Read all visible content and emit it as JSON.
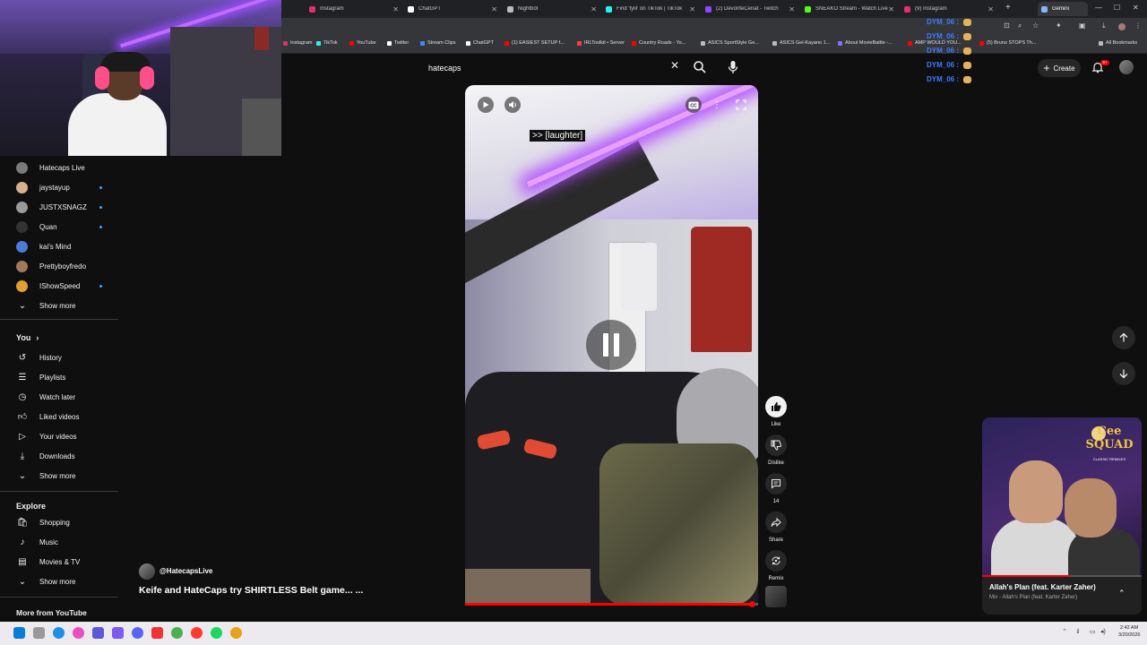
{
  "browser": {
    "tabs": [
      {
        "title": "Instagram",
        "color": "#e1306c"
      },
      {
        "title": "ChatGPT",
        "color": "#ffffff"
      },
      {
        "title": "Nightbot",
        "color": "#bbbbbb"
      },
      {
        "title": "Find 'tylil' on TikTok | TikTok",
        "color": "#25f4ee"
      },
      {
        "title": "(2) DevonteCenat - Twitch",
        "color": "#9146ff"
      },
      {
        "title": "SNEAKO Stream - Watch Live",
        "color": "#53fc18"
      },
      {
        "title": "(9) Instagram",
        "color": "#e1306c"
      },
      {
        "title": "Gemini",
        "color": "#8ab4f8"
      }
    ],
    "bookmarks": [
      {
        "label": "Instagram",
        "color": "#e1306c"
      },
      {
        "label": "TikTok",
        "color": "#25f4ee"
      },
      {
        "label": "YouTube",
        "color": "#ff0000"
      },
      {
        "label": "Twitter",
        "color": "#ffffff"
      },
      {
        "label": "Stream Clips",
        "color": "#4285f4"
      },
      {
        "label": "ChatGPT",
        "color": "#ffffff"
      },
      {
        "label": "(1) EASIEST SETUP f...",
        "color": "#ff0000"
      },
      {
        "label": "IRLToolkit • Server",
        "color": "#ff3b3b"
      },
      {
        "label": "Country Roads - Yo...",
        "color": "#ff0000"
      },
      {
        "label": "ASICS SportStyle Ge...",
        "color": "#bbbbbb"
      },
      {
        "label": "ASICS Gel-Kayano 1...",
        "color": "#bbbbbb"
      },
      {
        "label": "About MovieBattle -...",
        "color": "#8a6bff"
      },
      {
        "label": "AMP WOULD YOU...",
        "color": "#ff0000"
      },
      {
        "label": "(5) Bruno STOPS Th...",
        "color": "#ff0000"
      },
      {
        "label": "All Bookmarks",
        "color": "#bbbbbb"
      }
    ]
  },
  "search": {
    "value": "hatecaps"
  },
  "header": {
    "create_label": "Create",
    "notif_count": "9+"
  },
  "chat": {
    "lines": [
      {
        "user": "DYM_06 :"
      },
      {
        "user": "DYM_06 :"
      },
      {
        "user": "DYM_06 :"
      },
      {
        "user": "DYM_06 :"
      },
      {
        "user": "DYM_06 :"
      }
    ]
  },
  "sidebar": {
    "subscriptions": [
      {
        "name": "Hatecaps Live",
        "color": "#7a7a7a",
        "live": false
      },
      {
        "name": "jaystayup",
        "color": "#d6b18a",
        "live": true
      },
      {
        "name": "JUSTXSNAGZ",
        "color": "#999999",
        "live": true
      },
      {
        "name": "Quan",
        "color": "#333333",
        "live": true
      },
      {
        "name": "kai's Mind",
        "color": "#4a7bd8",
        "live": false
      },
      {
        "name": "Prettyboyfredo",
        "color": "#a07a5a",
        "live": false
      },
      {
        "name": "IShowSpeed",
        "color": "#e0a030",
        "live": true
      }
    ],
    "show_more_1": "Show more",
    "you_heading": "You",
    "you_items": [
      {
        "label": "History",
        "icon": "history-icon"
      },
      {
        "label": "Playlists",
        "icon": "playlists-icon"
      },
      {
        "label": "Watch later",
        "icon": "watch-later-icon"
      },
      {
        "label": "Liked videos",
        "icon": "liked-videos-icon"
      },
      {
        "label": "Your videos",
        "icon": "your-videos-icon"
      },
      {
        "label": "Downloads",
        "icon": "downloads-icon"
      }
    ],
    "show_more_2": "Show more",
    "explore_heading": "Explore",
    "explore_items": [
      {
        "label": "Shopping",
        "icon": "shopping-icon"
      },
      {
        "label": "Music",
        "icon": "music-icon"
      },
      {
        "label": "Movies & TV",
        "icon": "movies-icon"
      }
    ],
    "show_more_3": "Show more",
    "more_heading": "More from YouTube"
  },
  "video": {
    "caption": ">> [laughter]",
    "channel": "@HatecapsLive",
    "title": "Keife and HateCaps try SHIRTLESS Belt game... ...",
    "progress": 0.98
  },
  "actions": {
    "like": "Like",
    "dislike": "Dislike",
    "comments": "14",
    "share": "Share",
    "remix": "Remix"
  },
  "mini_player": {
    "title": "Allah's Plan (feat. Karter Zaher)",
    "subtitle": "Mix - Allah's Plan (feat. Karter Zaher)",
    "art_logo": "Cee SQUAD",
    "art_sub": "CLASSIC REMIXES",
    "progress": 0.55
  },
  "taskbar": {
    "time": "2:42 AM",
    "date": "3/20/2026"
  }
}
